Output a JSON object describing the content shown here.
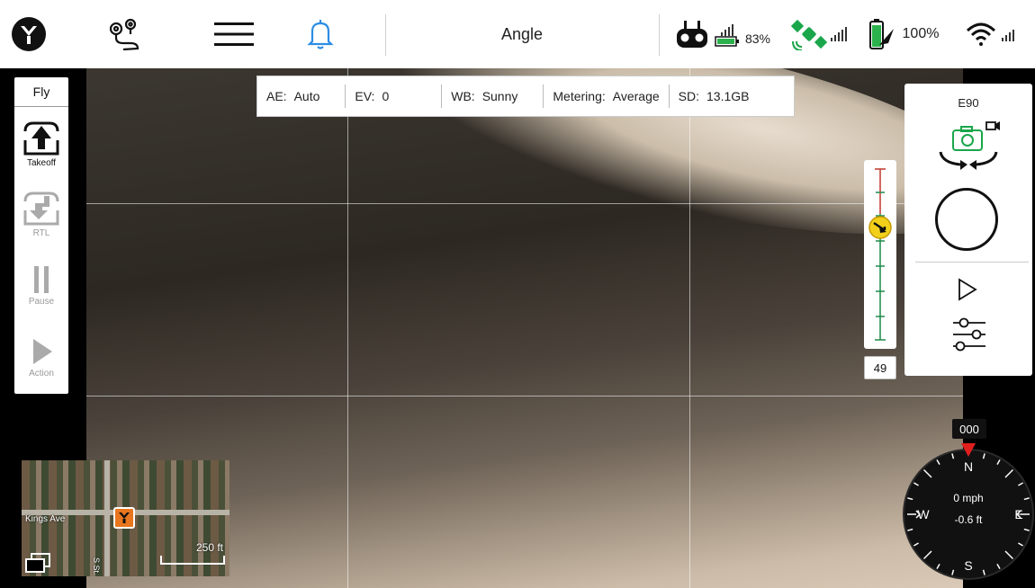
{
  "topbar": {
    "flight_mode": "Angle",
    "rc_signal_pct": "83%",
    "drone_battery_pct": "100%",
    "icons": [
      "logo-icon",
      "route-icon",
      "menu-icon",
      "bell-icon",
      "remote-controller-icon",
      "battery-icon",
      "gps-satellite-icon",
      "drone-battery-icon",
      "wifi-icon"
    ]
  },
  "camera_status": {
    "ae_label": "AE:",
    "ae_value": "Auto",
    "ev_label": "EV:",
    "ev_value": "0",
    "wb_label": "WB:",
    "wb_value": "Sunny",
    "metering_label": "Metering:",
    "metering_value": "Average",
    "sd_label": "SD:",
    "sd_value": "13.1GB"
  },
  "fly_panel": {
    "tab": "Fly",
    "takeoff": "Takeoff",
    "rtl": "RTL",
    "pause": "Pause",
    "action": "Action"
  },
  "camera_panel": {
    "model": "E90"
  },
  "gimbal": {
    "pitch_value": "49",
    "level_fraction": 0.66
  },
  "minimap": {
    "street": "Kings Ave",
    "street2": "S St.",
    "scale": "250 ft"
  },
  "compass": {
    "heading": "000",
    "speed": "0 mph",
    "altitude": "-0.6 ft",
    "n": "N",
    "e": "E",
    "s": "S",
    "w": "W"
  },
  "colors": {
    "accent_blue": "#2d8de3",
    "gps_green": "#1aa64a",
    "battery_green": "#2bb24c",
    "marker_orange": "#e8761e",
    "gimbal_yellow": "#f2d01a",
    "heading_red": "#e01e1e"
  }
}
